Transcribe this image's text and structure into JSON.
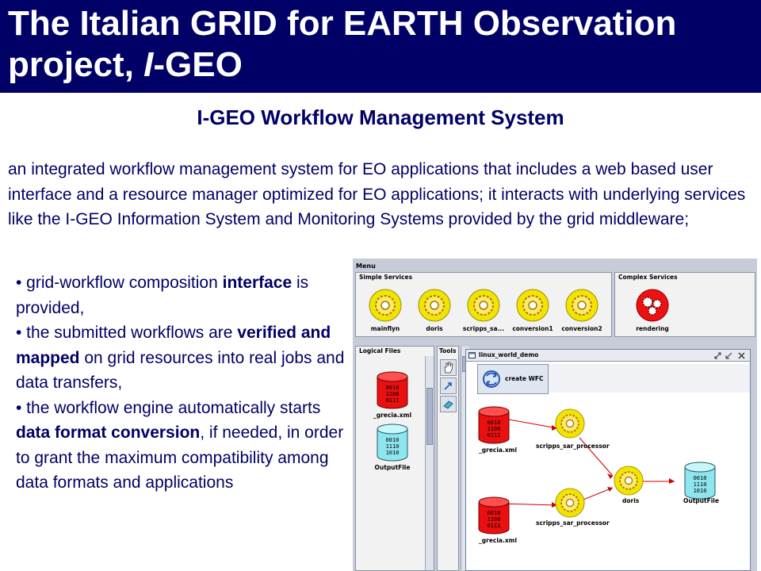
{
  "header": {
    "title_line1": "The Italian GRID for EARTH Observation",
    "title_line2_prefix": "project, ",
    "title_line2_italic": "I",
    "title_line2_suffix": "-GEO",
    "background": "#000066"
  },
  "subtitle": "I-GEO Workflow Management System",
  "intro": "an integrated workflow management system for EO applications that includes a web based user interface and a resource manager optimized for EO applications; it interacts with underlying services like the I-GEO Information System and Monitoring Systems provided by the grid middleware;",
  "bullets": [
    {
      "pre": "• grid-workflow composition ",
      "bold": "interface",
      "post": " is provided,"
    },
    {
      "pre": "• the submitted workflows are ",
      "bold": "verified and mapped",
      "post": " on grid resources into real jobs and data transfers,"
    },
    {
      "pre": "• the workflow engine automatically starts ",
      "bold": "data format conversion",
      "post": ", if needed, in order to grant the maximum compatibility among data formats and applications"
    }
  ],
  "app": {
    "menu_label": "Menu",
    "simple_services": {
      "title": "Simple Services",
      "items": [
        "mainflyn",
        "doris",
        "scripps_sa...",
        "conversion1",
        "conversion2"
      ]
    },
    "complex_services": {
      "title": "Complex Services",
      "items": [
        "rendering"
      ]
    },
    "logical_files": {
      "title": "Logical Files",
      "items": [
        {
          "label": "_grecia.xml",
          "bits": [
            "0010",
            "1100",
            "0111"
          ],
          "color": "red"
        },
        {
          "label": "OutputFile",
          "bits": [
            "0010",
            "1110",
            "1010"
          ],
          "color": "cyan"
        }
      ]
    },
    "tools": {
      "title": "Tools",
      "items": [
        "hand-icon",
        "arrow-icon",
        "eraser-icon"
      ]
    },
    "workflow_window": {
      "title": "linux_world_demo",
      "create_button": "create WFC",
      "nodes": {
        "file1": {
          "label": "_grecia.xml",
          "bits": [
            "0010",
            "1100",
            "0111"
          ]
        },
        "file2": {
          "label": "_grecia.xml",
          "bits": [
            "0010",
            "1100",
            "0111"
          ]
        },
        "proc1": "scripps_sar_processor",
        "proc2": "scripps_sar_processor",
        "doris": "doris",
        "output": {
          "label": "OutputFile",
          "bits": [
            "0010",
            "1110",
            "1010"
          ]
        }
      }
    }
  }
}
